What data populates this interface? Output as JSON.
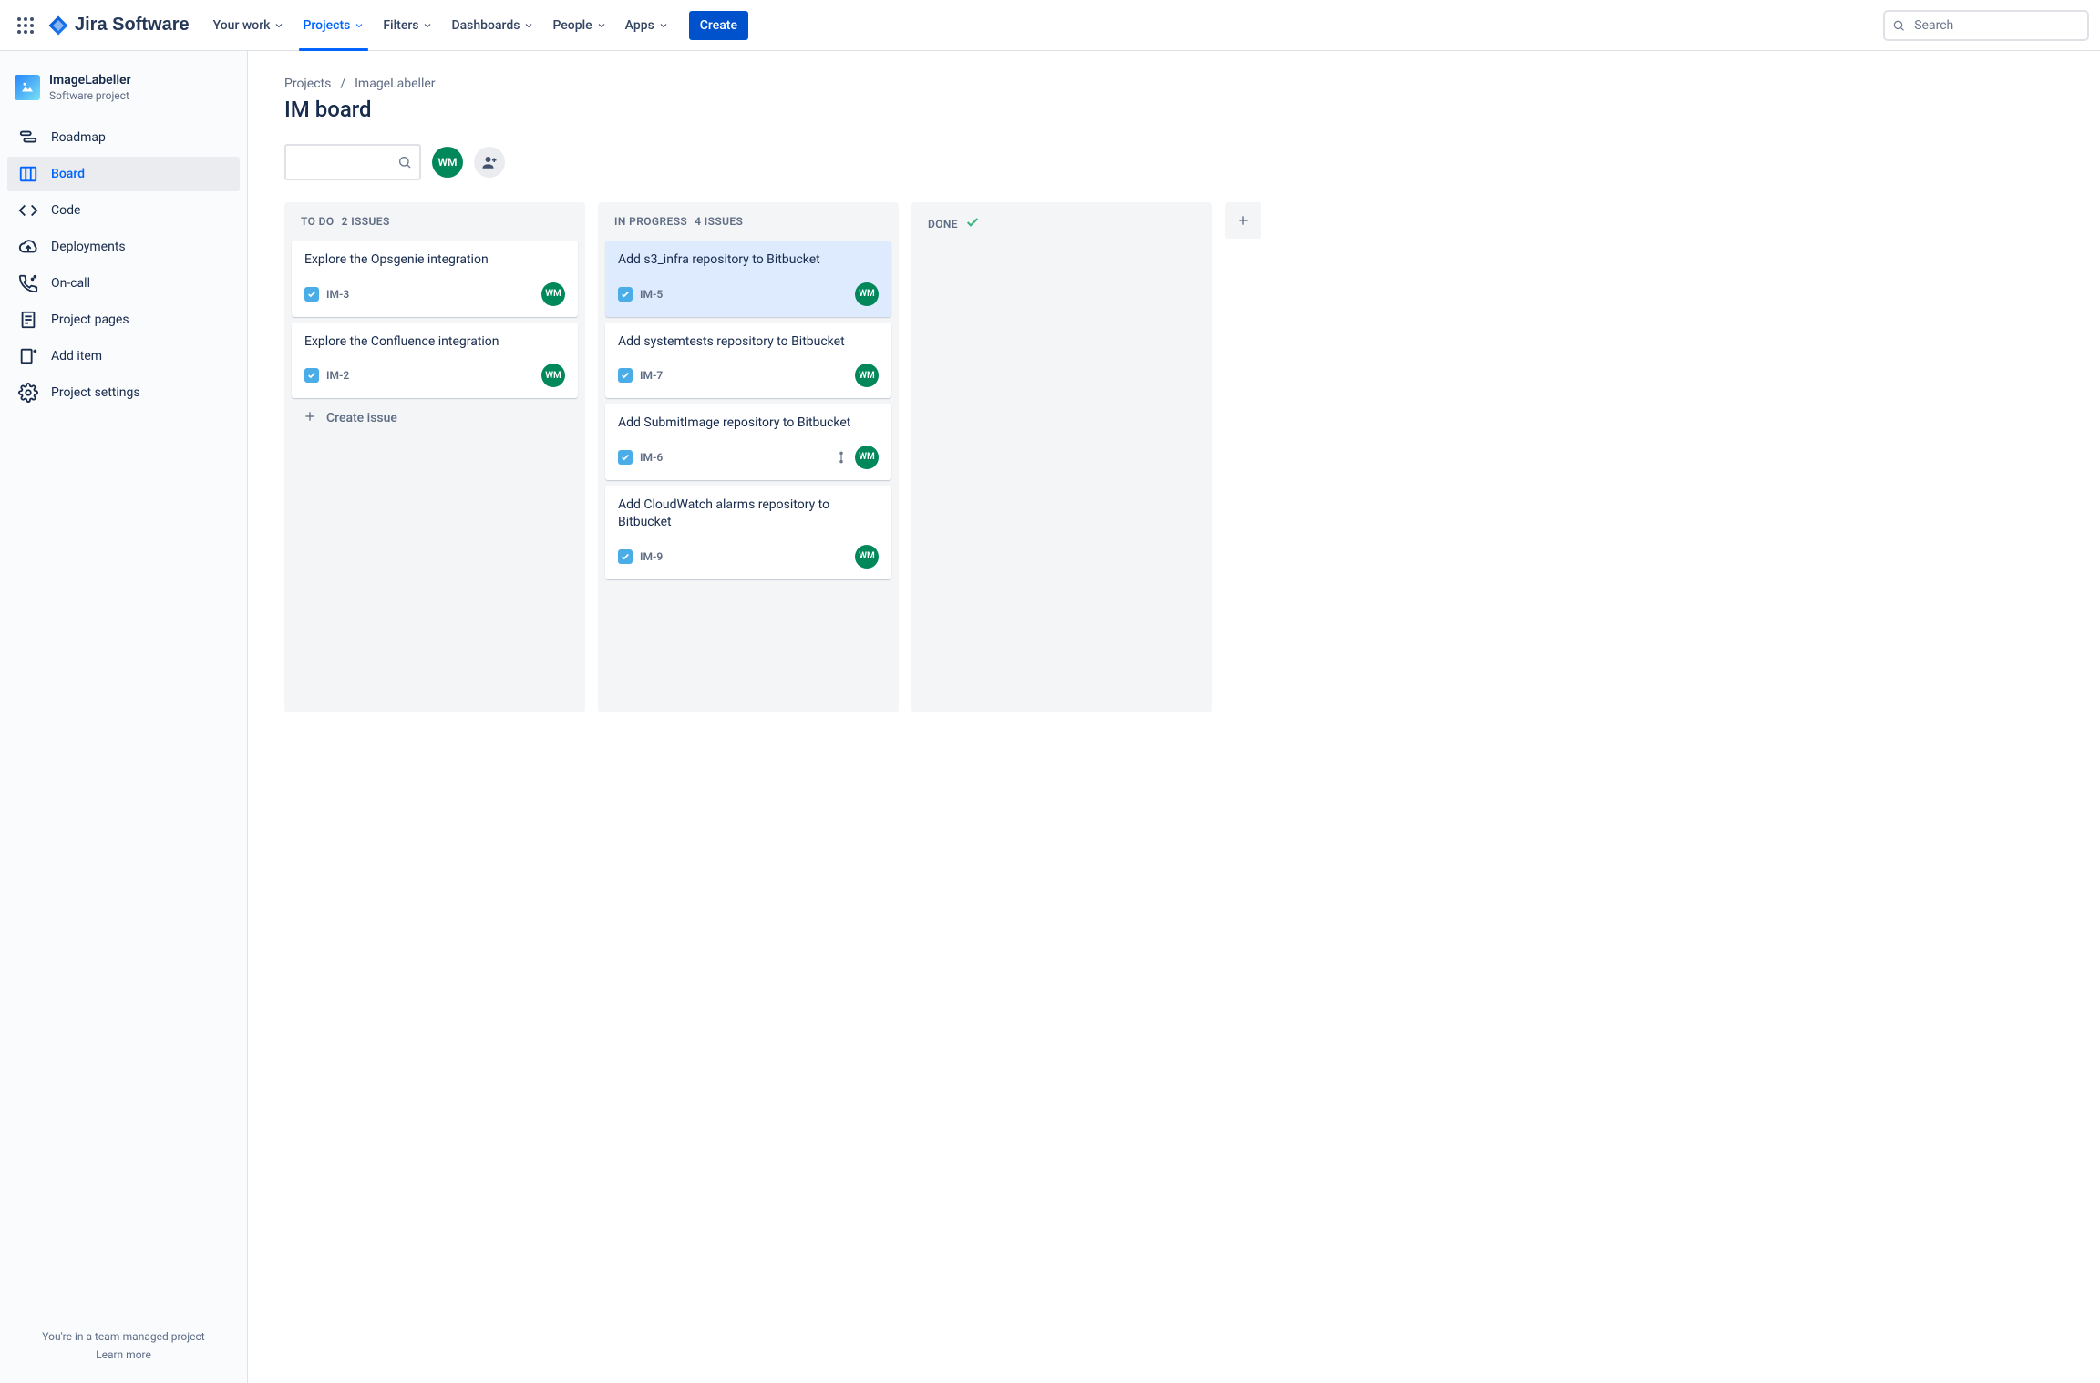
{
  "nav": {
    "logo_text": "Jira Software",
    "items": [
      {
        "label": "Your work"
      },
      {
        "label": "Projects",
        "active": true
      },
      {
        "label": "Filters"
      },
      {
        "label": "Dashboards"
      },
      {
        "label": "People"
      },
      {
        "label": "Apps"
      }
    ],
    "create_label": "Create",
    "search_placeholder": "Search"
  },
  "sidebar": {
    "project_name": "ImageLabeller",
    "project_type": "Software project",
    "items": [
      {
        "label": "Roadmap"
      },
      {
        "label": "Board",
        "active": true
      },
      {
        "label": "Code"
      },
      {
        "label": "Deployments"
      },
      {
        "label": "On-call"
      },
      {
        "label": "Project pages"
      },
      {
        "label": "Add item"
      },
      {
        "label": "Project settings"
      }
    ],
    "footer_line": "You're in a team-managed project",
    "footer_link": "Learn more"
  },
  "breadcrumbs": [
    "Projects",
    "ImageLabeller"
  ],
  "page_title": "IM board",
  "assignees": {
    "user_initials": "WM"
  },
  "columns": [
    {
      "title": "TO DO",
      "count_label": "2 ISSUES",
      "cards": [
        {
          "title": "Explore the Opsgenie integration",
          "key": "IM-3",
          "avatar": "WM"
        },
        {
          "title": "Explore the Confluence integration",
          "key": "IM-2",
          "avatar": "WM"
        }
      ],
      "create_label": "Create issue"
    },
    {
      "title": "IN PROGRESS",
      "count_label": "4 ISSUES",
      "cards": [
        {
          "title": "Add s3_infra repository to Bitbucket",
          "key": "IM-5",
          "avatar": "WM",
          "selected": true
        },
        {
          "title": "Add systemtests repository to Bitbucket",
          "key": "IM-7",
          "avatar": "WM"
        },
        {
          "title": "Add SubmitImage repository to Bitbucket",
          "key": "IM-6",
          "avatar": "WM",
          "priority": "medium"
        },
        {
          "title": "Add CloudWatch alarms repository to Bitbucket",
          "key": "IM-9",
          "avatar": "WM"
        }
      ]
    },
    {
      "title": "DONE",
      "done_check": true,
      "cards": []
    }
  ]
}
